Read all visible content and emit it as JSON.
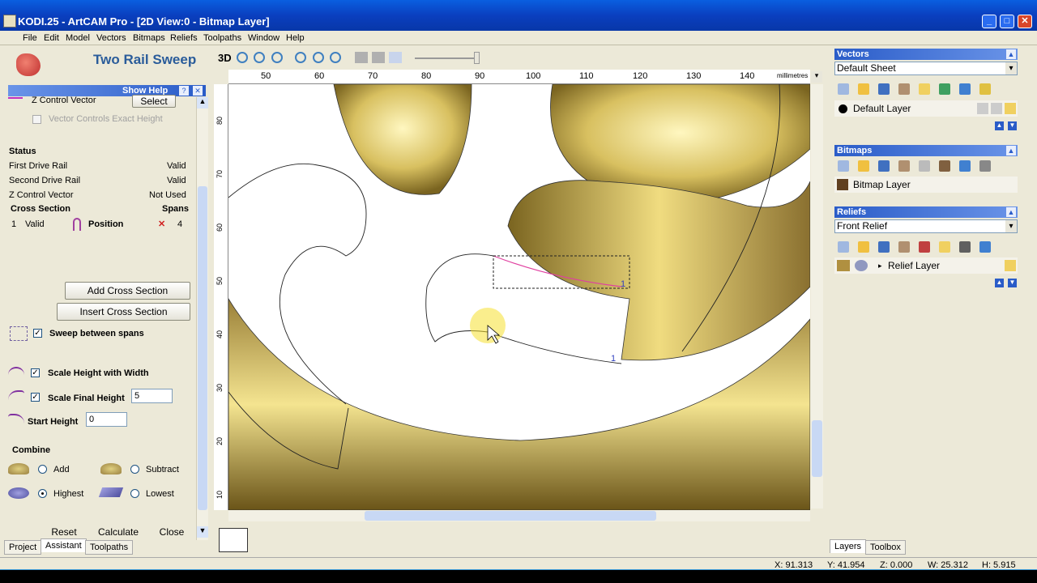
{
  "window": {
    "title": "KODI.25 - ArtCAM Pro - [2D View:0 - Bitmap Layer]"
  },
  "menu": [
    "File",
    "Edit",
    "Model",
    "Vectors",
    "Bitmaps",
    "Reliefs",
    "Toolpaths",
    "Window",
    "Help"
  ],
  "assistant": {
    "heading": "Two Rail Sweep",
    "show_help": "Show Help",
    "z_control_vector": "Z Control Vector",
    "select": "Select",
    "vector_controls": "Vector Controls Exact Height",
    "status_heading": "Status",
    "status": [
      {
        "label": "First Drive Rail",
        "value": "Valid"
      },
      {
        "label": "Second Drive Rail",
        "value": "Valid"
      },
      {
        "label": "Z Control Vector",
        "value": "Not Used"
      }
    ],
    "cross_section": "Cross Section",
    "spans": "Spans",
    "row": {
      "num": "1",
      "state": "Valid",
      "position": "Position",
      "spans": "4"
    },
    "add_cross_section": "Add Cross Section",
    "insert_cross_section": "Insert Cross Section",
    "sweep_between_spans": "Sweep between spans",
    "scale_height_width": "Scale Height with Width",
    "scale_final_height": "Scale Final Height",
    "scale_final_value": "5",
    "start_height": "Start Height",
    "start_height_value": "0",
    "combine": "Combine",
    "add": "Add",
    "subtract": "Subtract",
    "highest": "Highest",
    "lowest": "Lowest",
    "reset": "Reset",
    "calculate": "Calculate",
    "close": "Close",
    "tabs": [
      "Project",
      "Assistant",
      "Toolpaths"
    ]
  },
  "toolbar": {
    "label_3d": "3D"
  },
  "ruler": {
    "units": "millimetres",
    "top": [
      "50",
      "60",
      "70",
      "80",
      "90",
      "100",
      "110",
      "120",
      "130",
      "140"
    ],
    "left": [
      "80",
      "70",
      "60",
      "50",
      "40",
      "30",
      "20",
      "10"
    ]
  },
  "canvas": {
    "marker_start": "1",
    "marker_end": "1"
  },
  "right": {
    "vectors": "Vectors",
    "vectors_sheet": "Default Sheet",
    "default_layer": "Default Layer",
    "bitmaps": "Bitmaps",
    "bitmap_layer": "Bitmap Layer",
    "reliefs": "Reliefs",
    "reliefs_sheet": "Front Relief",
    "relief_layer": "Relief Layer",
    "tabs": [
      "Layers",
      "Toolbox"
    ]
  },
  "status": {
    "x": "X: 91.313",
    "y": "Y: 41.954",
    "z": "Z: 0.000",
    "w": "W: 25.312",
    "h": "H: 5.915"
  },
  "colors": {
    "title": "#0a3fbf",
    "gold": "#e8d070",
    "accent": "#2a5cc8"
  }
}
